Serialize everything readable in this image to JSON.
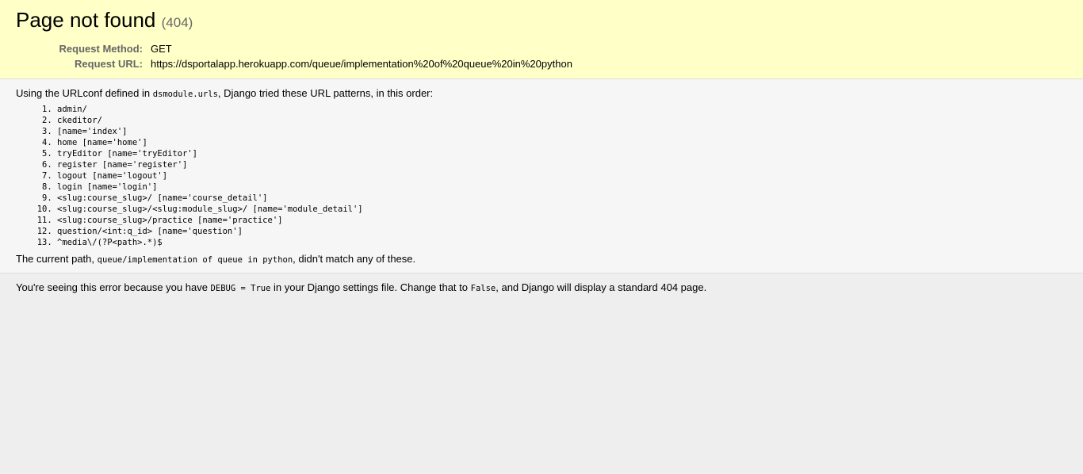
{
  "summary": {
    "title": "Page not found",
    "status_code": "(404)",
    "request_method_label": "Request Method:",
    "request_method": "GET",
    "request_url_label": "Request URL:",
    "request_url": "https://dsportalapp.herokuapp.com/queue/implementation%20of%20queue%20in%20python"
  },
  "info": {
    "intro_before": "Using the URLconf defined in ",
    "urlconf": "dsmodule.urls",
    "intro_after": ", Django tried these URL patterns, in this order:",
    "patterns": [
      "admin/",
      "ckeditor/",
      "[name='index']",
      "home [name='home']",
      "tryEditor [name='tryEditor']",
      "register [name='register']",
      "logout [name='logout']",
      "login [name='login']",
      "<slug:course_slug>/ [name='course_detail']",
      "<slug:course_slug>/<slug:module_slug>/ [name='module_detail']",
      "<slug:course_slug>/practice [name='practice']",
      "question/<int:q_id> [name='question']",
      "^media\\/(?P<path>.*)$"
    ],
    "current_path_before": "The current path, ",
    "current_path": "queue/implementation of queue in python",
    "current_path_after": ", didn't match any of these."
  },
  "explanation": {
    "text_1": "You're seeing this error because you have ",
    "debug_code": "DEBUG = True",
    "text_2": " in your Django settings file. Change that to ",
    "false_code": "False",
    "text_3": ", and Django will display a standard 404 page."
  }
}
